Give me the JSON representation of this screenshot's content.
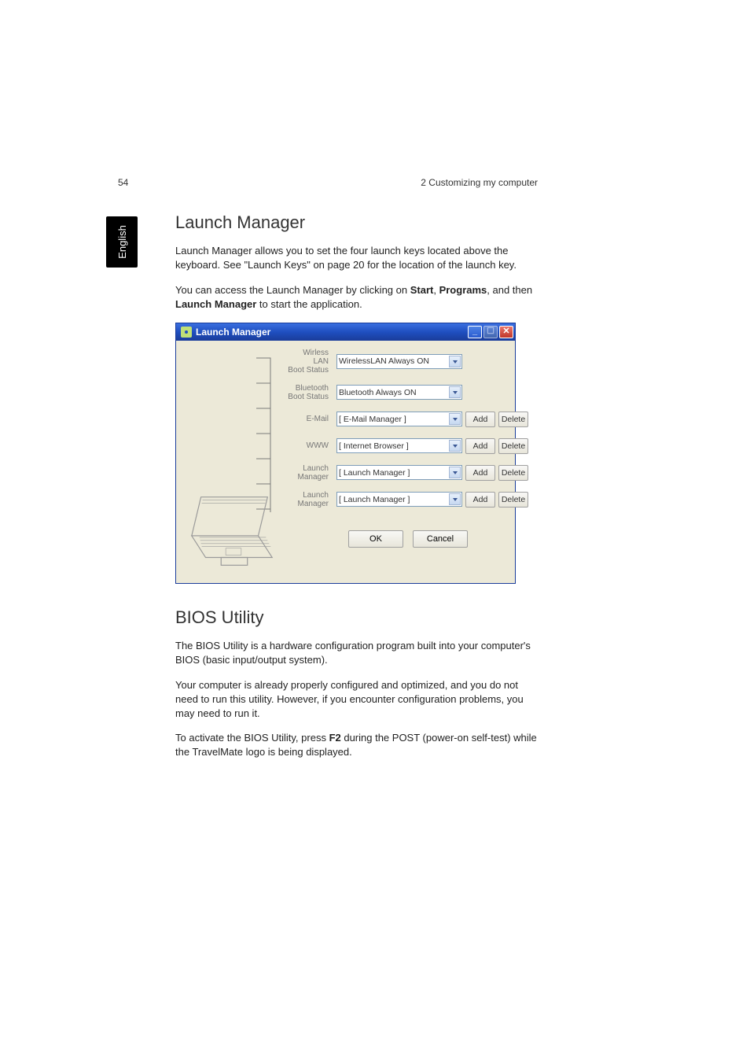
{
  "header": {
    "page_number": "54",
    "chapter": "2 Customizing my computer"
  },
  "side_tab": "English",
  "section1": {
    "title": "Launch Manager",
    "para1_pre": "Launch Manager allows you to set the four launch keys located above the keyboard. See \"Launch Keys\" on page 20 for the location of the launch key.",
    "para2_pre": "You can access the Launch Manager by clicking on ",
    "bold1": "Start",
    "sep1": ", ",
    "bold2": "Programs",
    "sep2": ", and then ",
    "bold3": "Launch Manager",
    "para2_post": " to start the application."
  },
  "launch_manager_window": {
    "title": "Launch Manager",
    "rows": [
      {
        "label_line1": "Wirless LAN",
        "label_line2": "Boot Status",
        "value": "WirelessLAN Always ON",
        "add": "",
        "del": ""
      },
      {
        "label_line1": "Bluetooth",
        "label_line2": "Boot Status",
        "value": "Bluetooth Always ON",
        "add": "",
        "del": ""
      },
      {
        "label_line1": "E-Mail",
        "label_line2": "",
        "value": "[ E-Mail Manager ]",
        "add": "Add",
        "del": "Delete"
      },
      {
        "label_line1": "WWW",
        "label_line2": "",
        "value": "[ Internet Browser ]",
        "add": "Add",
        "del": "Delete"
      },
      {
        "label_line1": "Launch",
        "label_line2": "Manager",
        "value": "[ Launch Manager ]",
        "add": "Add",
        "del": "Delete"
      },
      {
        "label_line1": "Launch",
        "label_line2": "Manager",
        "value": "[ Launch Manager ]",
        "add": "Add",
        "del": "Delete"
      }
    ],
    "ok": "OK",
    "cancel": "Cancel"
  },
  "section2": {
    "title": "BIOS Utility",
    "para1": "The BIOS Utility is a hardware configuration program built into your computer's BIOS (basic input/output system).",
    "para2": "Your computer is already properly configured and optimized, and you do not need to run this utility. However, if you encounter configuration problems, you may need to run it.",
    "para3_pre": "To activate the BIOS Utility, press ",
    "bold1": "F2",
    "para3_post": " during the POST (power-on self-test) while the TravelMate logo is being displayed."
  }
}
